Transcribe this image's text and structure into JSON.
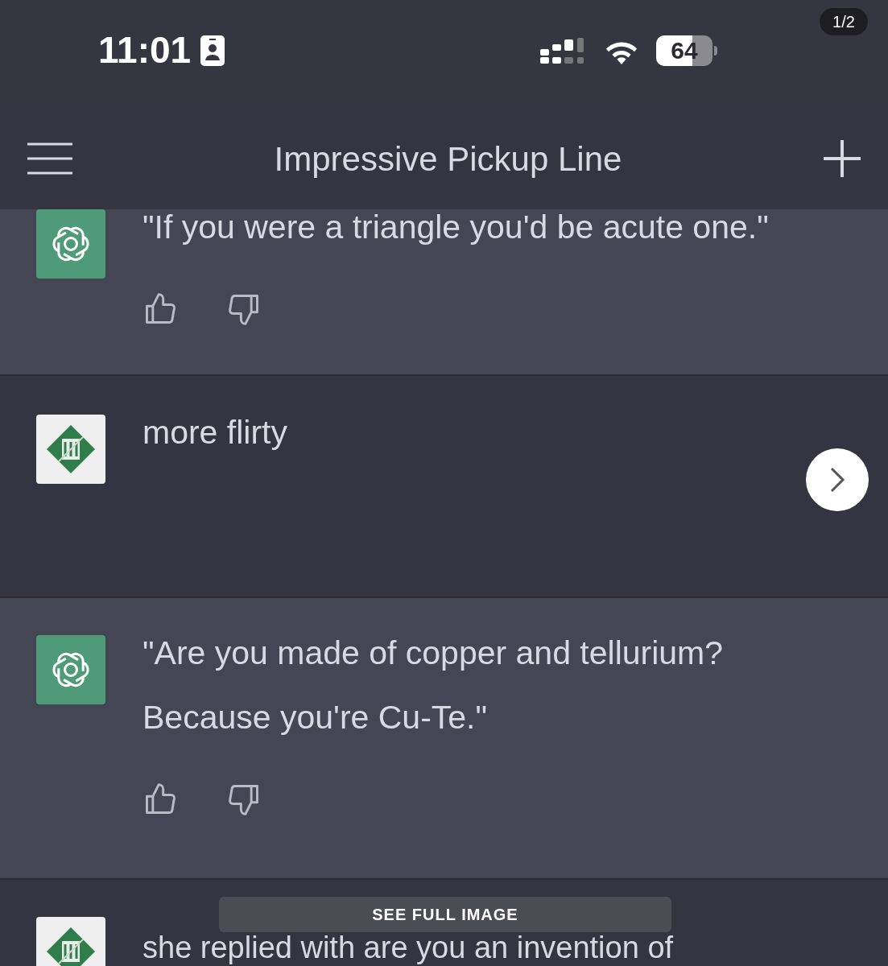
{
  "status_bar": {
    "time": "11:01",
    "battery": "64"
  },
  "viewer": {
    "counter": "1/2",
    "see_full_image": "SEE FULL IMAGE"
  },
  "header": {
    "title": "Impressive Pickup Line"
  },
  "messages": [
    {
      "kind": "assistant",
      "text": "\"If you were a triangle you'd be acute one.\""
    },
    {
      "kind": "user",
      "text": "more flirty"
    },
    {
      "kind": "assistant",
      "text": "\"Are you made of copper and tellurium? Because you're Cu-Te.\""
    },
    {
      "kind": "user",
      "text": "she replied with are you an invention of"
    }
  ]
}
